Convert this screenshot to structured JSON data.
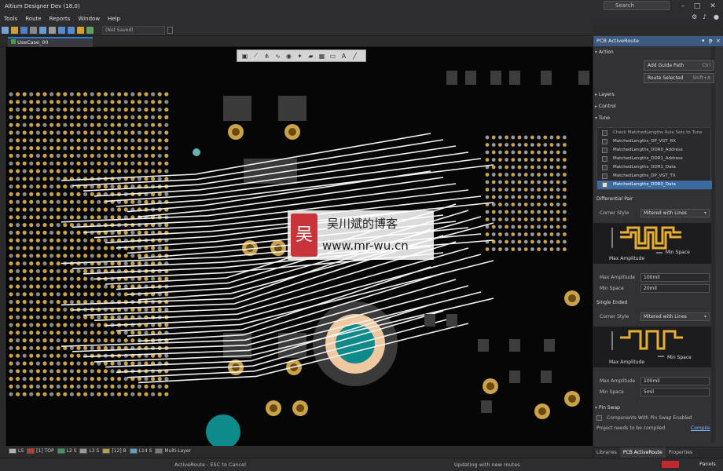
{
  "app": {
    "title": "Altium Designer Dev (18.0)",
    "search_placeholder": "Search"
  },
  "menu": [
    "Tools",
    "Route",
    "Reports",
    "Window",
    "Help"
  ],
  "toolbar": {
    "not_saved": "(Not Saved)"
  },
  "document": {
    "tab_label": "UseCase_00 TuneRules.PcbDoc"
  },
  "watermark": {
    "logo": "吴",
    "name": "吴川斌的博客",
    "url": "www.mr-wu.cn"
  },
  "layers": [
    {
      "label": "LS",
      "color": "#b0b0b0"
    },
    {
      "label": "[1] TOP",
      "color": "#c0392b"
    },
    {
      "label": "L2 S",
      "color": "#3a9a5a"
    },
    {
      "label": "L3 S",
      "color": "#9a9a9a"
    },
    {
      "label": "[12] B",
      "color": "#b8a040"
    },
    {
      "label": "L14 S",
      "color": "#5aa0c0"
    },
    {
      "label": "Multi-Layer",
      "color": "#777777"
    }
  ],
  "status": {
    "left": "ActiveRoute - ESC to Cancel",
    "mid": "Updating with new routes",
    "badge": "",
    "right": "Panels"
  },
  "panel": {
    "title": "PCB ActiveRoute",
    "action": {
      "label": "Action",
      "add_guide": "Add Guide Path",
      "add_guide_key": "Ctrl",
      "route_selected": "Route Selected",
      "route_selected_key": "Shift+A"
    },
    "layers_label": "Layers",
    "control_label": "Control",
    "tune": {
      "label": "Tune",
      "header": "Check MatchedLengths Rule Sets to Tune",
      "rows": [
        "MatchedLengths_DP_VGT_RX",
        "MatchedLengths_DDR0_Address",
        "MatchedLengths_DDR1_Address",
        "MatchedLengths_DDR1_Data",
        "MatchedLengths_DP_VGT_TX",
        "MatchedLengths_DDR0_Data"
      ],
      "selected_index": 5
    },
    "diff_pair": {
      "label": "Differential Pair",
      "corner_style_label": "Corner Style",
      "corner_style": "Mitered with Lines",
      "max_amp_label": "Max Amplitude",
      "min_space_label": "Min Space",
      "max_amp": "100mil",
      "min_space": "20mil"
    },
    "single_ended": {
      "label": "Single Ended",
      "corner_style_label": "Corner Style",
      "corner_style": "Mitered with Lines",
      "max_amp_label": "Max Amplitude",
      "min_space_label": "Min Space",
      "max_amp": "100mil",
      "min_space": "5mil"
    },
    "pin_swap": {
      "label": "Pin Swap",
      "checkbox": "Components With Pin Swap Enabled",
      "note": "Project needs to be compiled",
      "compile_link": "Compile"
    },
    "tabs": [
      "Libraries",
      "PCB ActiveRoute",
      "Properties"
    ],
    "active_tab": 1
  }
}
